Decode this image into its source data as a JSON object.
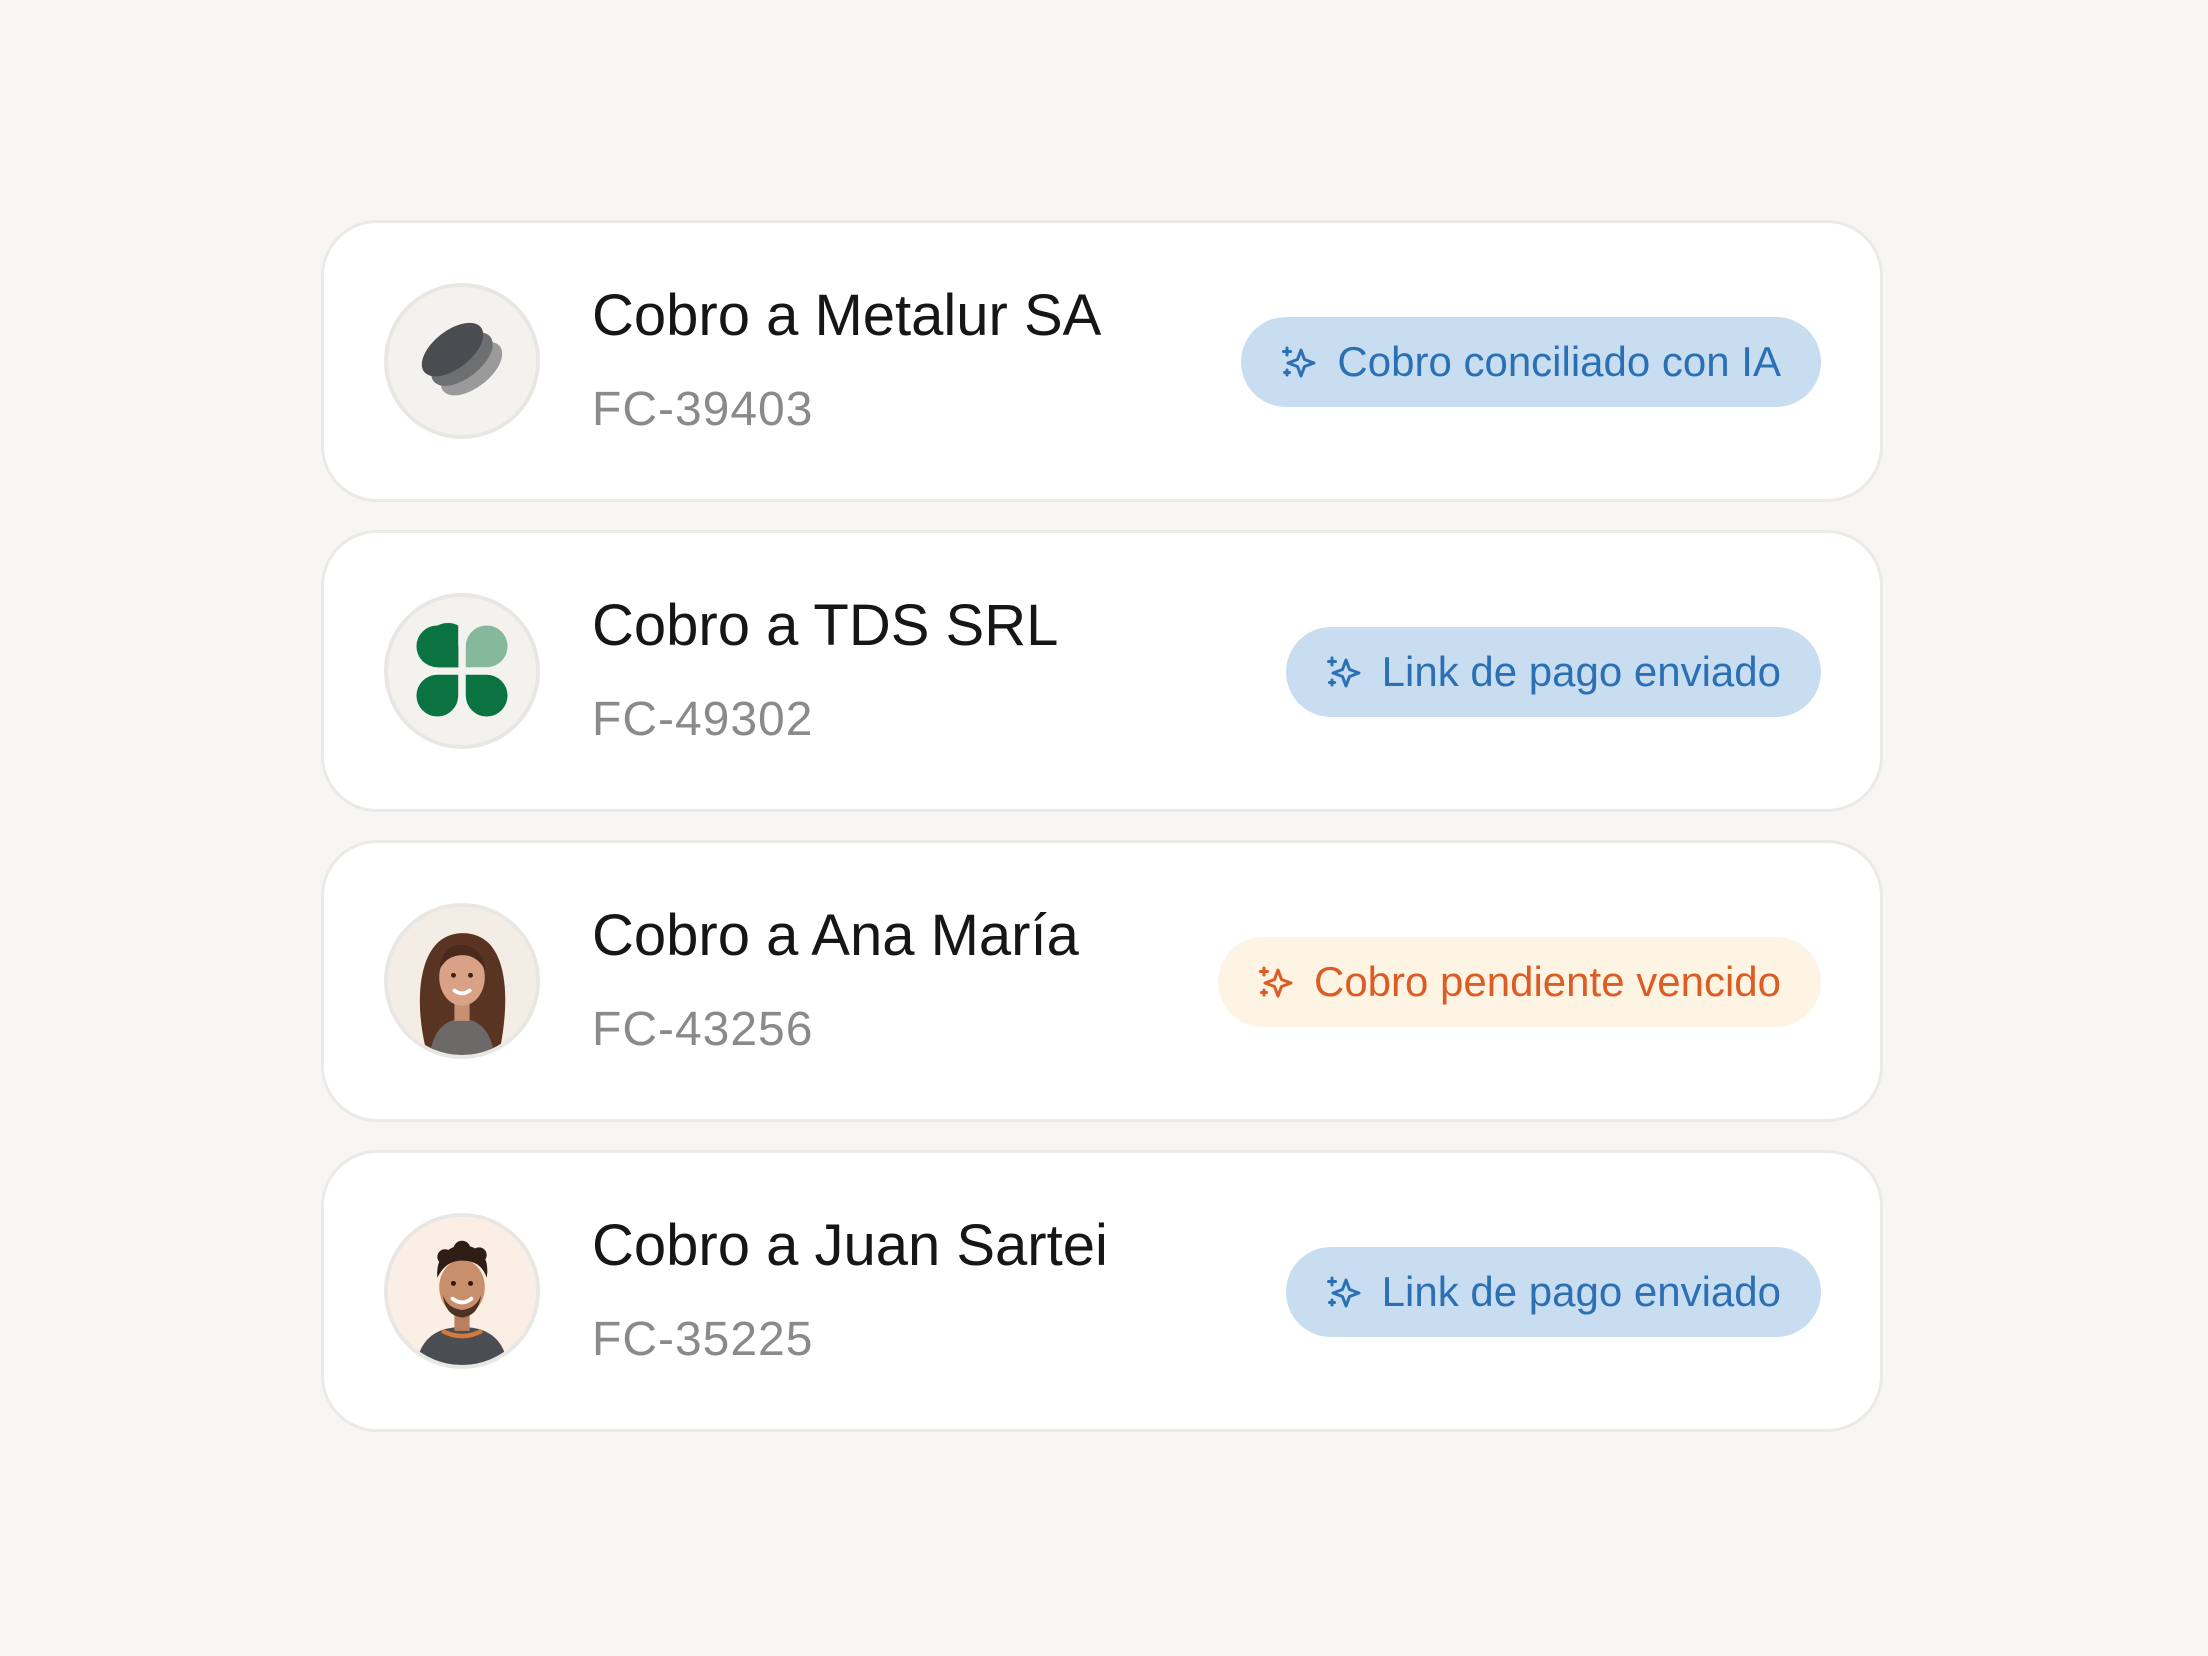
{
  "colors": {
    "background": "#f7f6f4",
    "card": "#ffffff",
    "card_border": "#ebeae7",
    "title": "#161616",
    "code": "#8a8a8a",
    "pill_blue_bg": "#c8ddef",
    "pill_blue_text": "#2b70b5",
    "pill_orange_bg": "#fdf4e4",
    "pill_orange_text": "#dc5c24"
  },
  "items": [
    {
      "title": "Cobro a Metalur SA",
      "code": "FC-39403",
      "avatar": "metalur-logo-icon",
      "status": {
        "label": "Cobro conciliado con IA",
        "tone": "blue",
        "icon": "sparkle-icon"
      }
    },
    {
      "title": "Cobro a TDS SRL",
      "code": "FC-49302",
      "avatar": "clover-logo-icon",
      "status": {
        "label": "Link de pago enviado",
        "tone": "blue",
        "icon": "sparkle-icon"
      }
    },
    {
      "title": "Cobro a Ana María",
      "code": "FC-43256",
      "avatar": "person-photo-ana",
      "status": {
        "label": "Cobro pendiente vencido",
        "tone": "orange",
        "icon": "sparkle-icon"
      }
    },
    {
      "title": "Cobro a Juan Sartei",
      "code": "FC-35225",
      "avatar": "person-photo-juan",
      "status": {
        "label": "Link de pago enviado",
        "tone": "blue",
        "icon": "sparkle-icon"
      }
    }
  ]
}
